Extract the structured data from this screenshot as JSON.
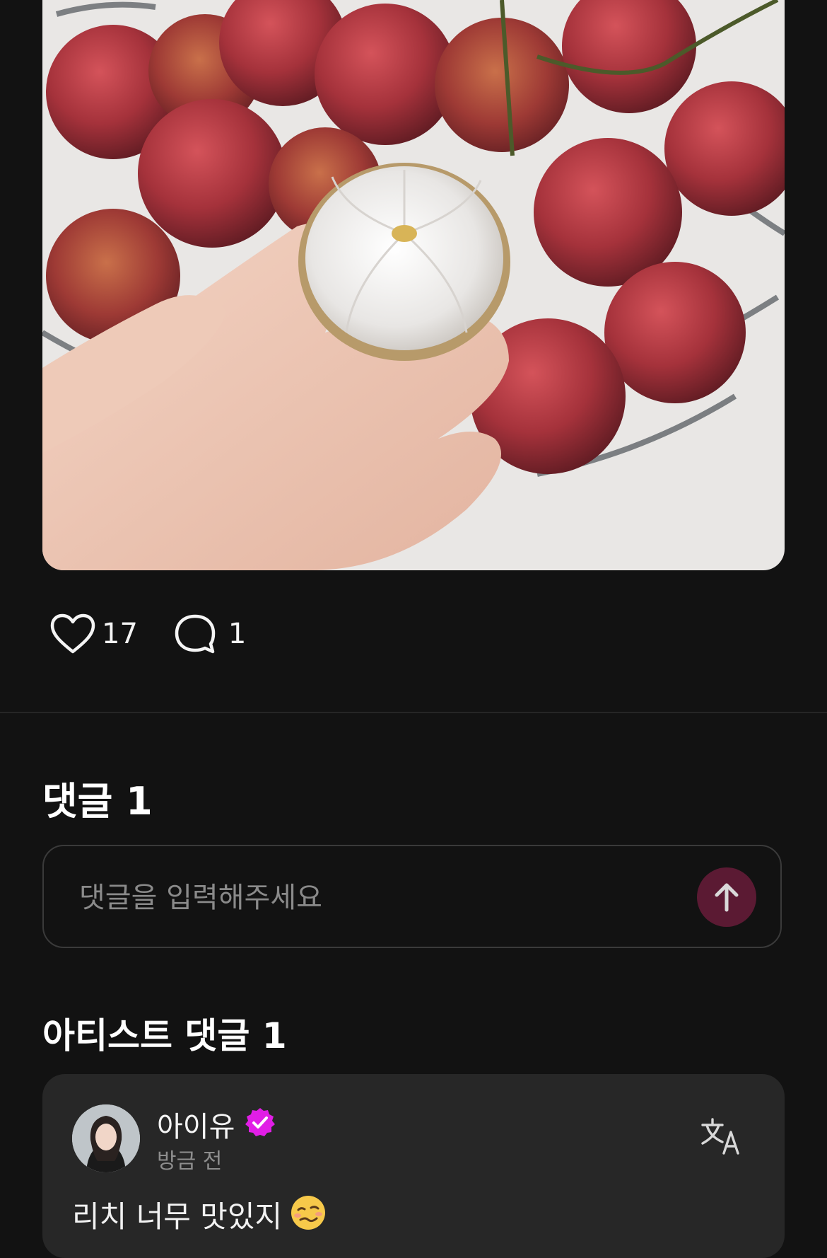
{
  "post": {
    "photo_alt": "lychee-photo"
  },
  "actions": {
    "like_count": "17",
    "comment_count": "1"
  },
  "comments_section": {
    "title": "댓글 1",
    "input_placeholder": "댓글을 입력해주세요"
  },
  "artist_section": {
    "title": "아티스트 댓글 1",
    "comment": {
      "author": "아이유",
      "time": "방금 전",
      "text": "리치 너무 맛있지"
    }
  },
  "colors": {
    "background": "#121212",
    "send_button": "#5b1a33",
    "verified_badge": "#e11ee6",
    "card": "#272727"
  },
  "icons": {
    "like": "heart-icon",
    "comment": "speech-bubble-icon",
    "send": "arrow-up-icon",
    "verified": "verified-badge-icon",
    "translate": "translate-icon",
    "emoji": "woozy-face-emoji"
  }
}
